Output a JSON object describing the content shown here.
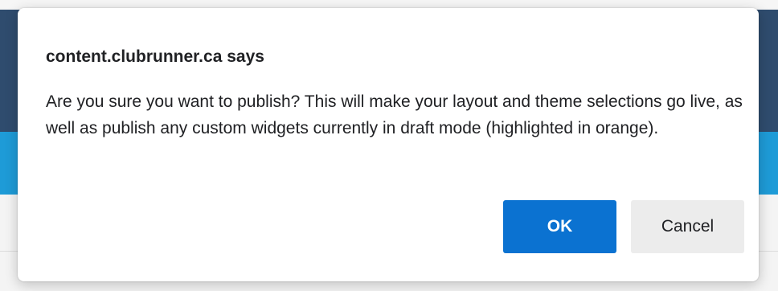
{
  "dialog": {
    "title": "content.clubrunner.ca says",
    "message": "Are you sure you want to publish? This will make your layout and theme selections go live, as well as publish any custom widgets currently in draft mode (highlighted in orange).",
    "ok_label": "OK",
    "cancel_label": "Cancel"
  },
  "colors": {
    "ok_button": "#0b72d1",
    "cancel_button": "#ececec",
    "background_header": "#2f4c6e",
    "background_banner": "#1e9bd7"
  }
}
